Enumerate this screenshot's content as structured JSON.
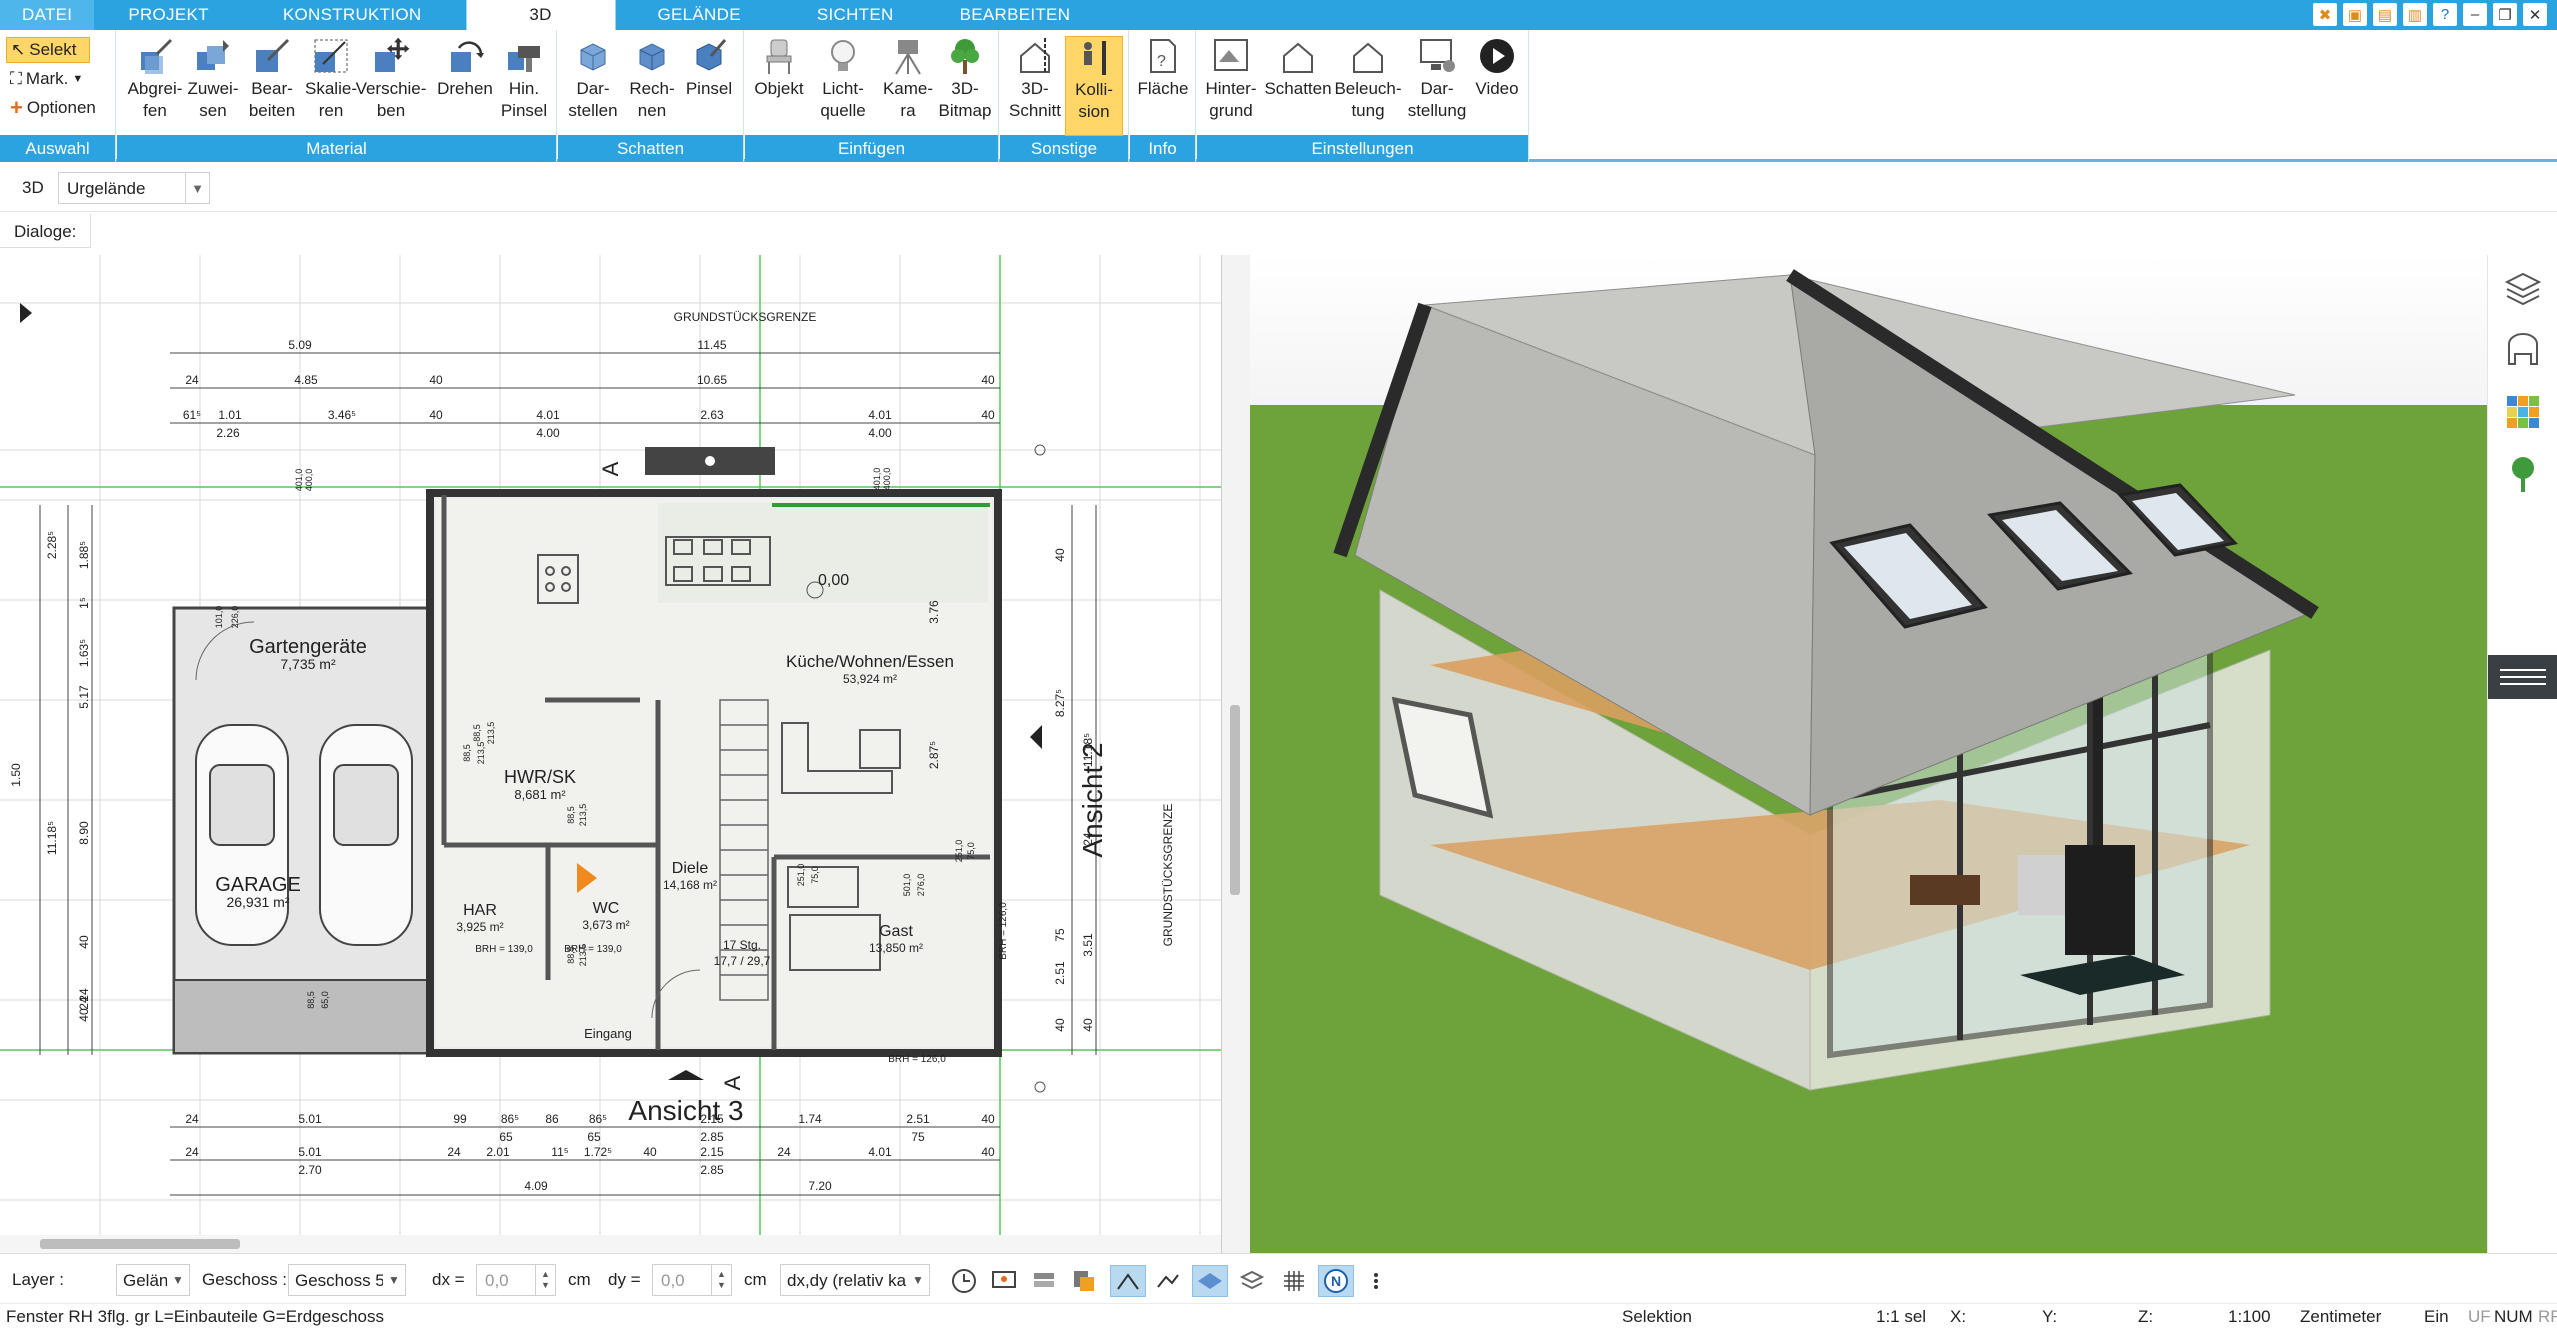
{
  "tabs": [
    {
      "label": "DATEI"
    },
    {
      "label": "PROJEKT"
    },
    {
      "label": "KONSTRUKTION"
    },
    {
      "label": "3D"
    },
    {
      "label": "GELÄNDE"
    },
    {
      "label": "SICHTEN"
    },
    {
      "label": "BEARBEITEN"
    }
  ],
  "ribbon": {
    "auswahl": {
      "label": "Auswahl",
      "selekt": "Selekt",
      "mark": "Mark.",
      "optionen": "Optionen"
    },
    "material": {
      "label": "Material",
      "buttons": [
        "Abgrei-\nfen",
        "Zuwei-\nsen",
        "Bear-\nbeiten",
        "Skalie-\nren",
        "Verschie-\nben",
        "Drehen",
        "Hin.\nPinsel"
      ]
    },
    "schatten": {
      "label": "Schatten",
      "buttons": [
        "Dar-\nstellen",
        "Rech-\nnen",
        "Pinsel"
      ]
    },
    "einfuegen": {
      "label": "Einfügen",
      "buttons": [
        "Objekt",
        "Licht-\nquelle",
        "Kame-\nra",
        "3D-\nBitmap"
      ]
    },
    "sonstige": {
      "label": "Sonstige",
      "buttons": [
        "3D-\nSchnitt",
        "Kolli-\nsion"
      ]
    },
    "info": {
      "label": "Info",
      "buttons": [
        "Fläche"
      ]
    },
    "einstellungen": {
      "label": "Einstellungen",
      "buttons": [
        "Hinter-\ngrund",
        "Schatten",
        "Beleuch-\ntung",
        "Dar-\nstellung",
        "Video"
      ]
    }
  },
  "view": {
    "tag": "3D",
    "selected": "Urgelände",
    "dialoge": "Dialoge:"
  },
  "plan": {
    "grundstuecksgrenze": "GRUNDSTÜCKSGRENZE",
    "rooms": [
      {
        "name": "Gartengeräte",
        "area": "7,735 m²"
      },
      {
        "name": "GARAGE",
        "area": "26,931 m²"
      },
      {
        "name": "HWR/SK",
        "area": "8,681 m²"
      },
      {
        "name": "Küche/Wohnen/Essen",
        "area": "53,924 m²"
      },
      {
        "name": "HAR",
        "area": "3,925 m²"
      },
      {
        "name": "WC",
        "area": "3,673 m²"
      },
      {
        "name": "Diele",
        "area": "14,168 m²"
      },
      {
        "name": "Gast",
        "area": "13,850 m²"
      }
    ],
    "level": "0,00",
    "stairs": "17 Stg.",
    "stairs2": "17,7 / 29,7",
    "eingang": "Eingang",
    "ansicht2": "Ansicht 2",
    "ansicht3": "Ansicht 3",
    "section": "A",
    "brh1": "BRH = 139,0",
    "brh2": "BRH = 139,0",
    "brh3": "BRH = 126,0",
    "brh4": "BRH = 126,0",
    "dims_top1": [
      "5.09",
      "11.45"
    ],
    "dims_top2": [
      "24",
      "4.85",
      "40",
      "10.65",
      "40"
    ],
    "dims_top3": [
      "61⁵",
      "1.01",
      "3.46⁵",
      "40",
      "4.01",
      "2.63",
      "4.01",
      "40"
    ],
    "dims_top3b": [
      "2.26",
      "4.00",
      "4.00"
    ],
    "dims_bot1": [
      "24",
      "5.01",
      "99",
      "86⁵",
      "86",
      "86⁵",
      "2.15",
      "1.74",
      "2.51",
      "40"
    ],
    "dims_bot1b": [
      "65",
      "65",
      "2.85",
      "75"
    ],
    "dims_bot2": [
      "24",
      "5.01",
      "24",
      "2.01",
      "11⁵",
      "1.72⁵",
      "40",
      "2.15",
      "24",
      "4.01",
      "40"
    ],
    "dims_bot2b": [
      "2.70",
      "2.85"
    ],
    "dims_bot3": [
      "4.09",
      "7.20"
    ],
    "dims_left": [
      "2.28⁵",
      "1.88⁵",
      "1⁵",
      "1.63⁵",
      "5.17",
      "8.90",
      "11.18⁵",
      "1.50",
      "24",
      "24",
      "40",
      "40"
    ],
    "dims_right": [
      "8.27⁵",
      "11.18⁵",
      "3.76",
      "2.87⁵",
      "24",
      "3.51",
      "2.51",
      "75",
      "40",
      "40",
      "40"
    ],
    "dims_small": [
      "101,0",
      "226,0",
      "88,5",
      "213,5",
      "88,5",
      "213,5",
      "88,5",
      "213,5",
      "88,5",
      "213,5",
      "251,0",
      "75,0",
      "251,0",
      "75,0",
      "501,0",
      "276,0",
      "88,5",
      "65,0",
      "401,0",
      "400,0",
      "401,0",
      "400,0"
    ]
  },
  "status": {
    "layer_label": "Layer :",
    "layer": "Gelände",
    "geschoss_label": "Geschoss :",
    "geschoss": "Geschoss 5",
    "dx_label": "dx =",
    "dx": "0,0",
    "dx_unit": "cm",
    "dy_label": "dy =",
    "dy": "0,0",
    "dy_unit": "cm",
    "mode": "dx,dy (relativ ka"
  },
  "info": {
    "left": "Fenster RH 3flg. gr L=Einbauteile G=Erdgeschoss",
    "mode": "Selektion",
    "sel": "1:1 sel",
    "x": "X:",
    "y": "Y:",
    "z": "Z:",
    "scale": "1:100",
    "unit": "Zentimeter",
    "ein": "Ein",
    "uf": "UF",
    "num": "NUM",
    "rf": "RF"
  },
  "colors": {
    "accent": "#2aa3e0",
    "highlight": "#ffd667",
    "grass": "#6ea23a"
  }
}
